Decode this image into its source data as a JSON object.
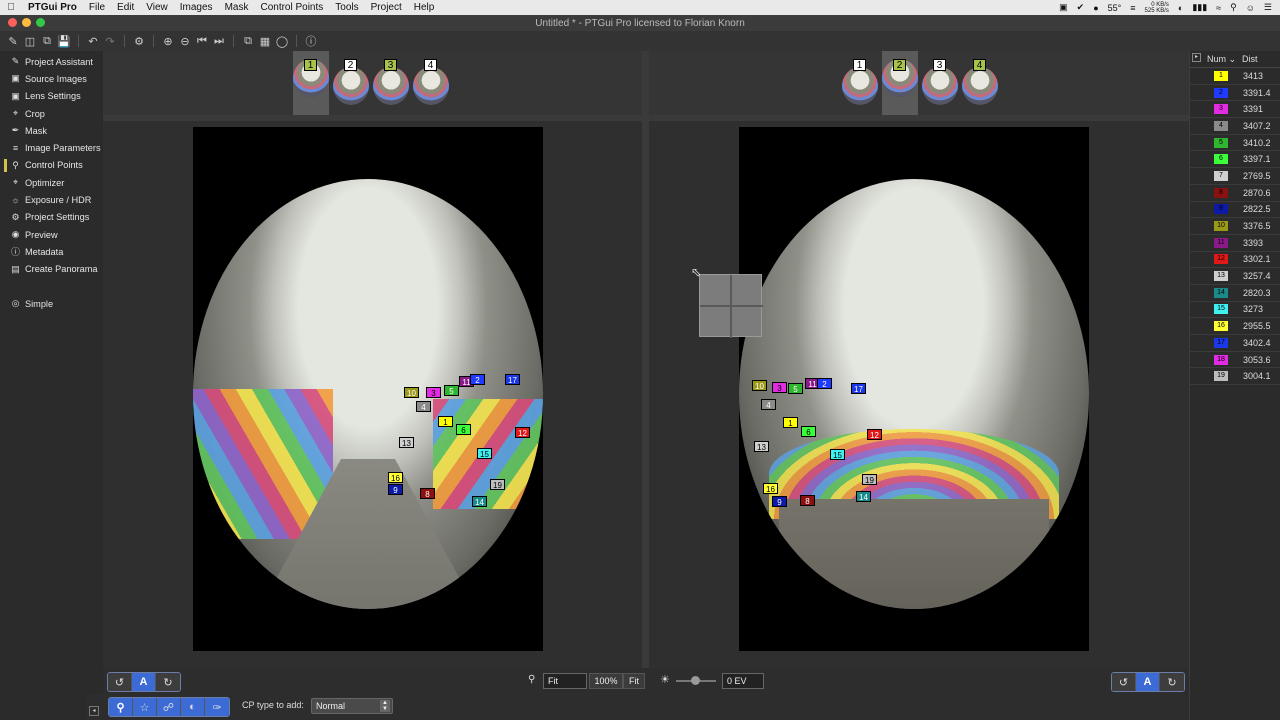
{
  "menubar": {
    "app_name": "PTGui Pro",
    "items": [
      "File",
      "Edit",
      "View",
      "Images",
      "Mask",
      "Control Points",
      "Tools",
      "Project",
      "Help"
    ],
    "temperature": "55°",
    "net_up": "0 KB/s",
    "net_down": "525 KB/s"
  },
  "window": {
    "title": "Untitled * - PTGui Pro licensed to Florian Knorn"
  },
  "sidebar": {
    "items": [
      {
        "label": "Project Assistant",
        "icon": "pencil-icon"
      },
      {
        "label": "Source Images",
        "icon": "images-icon"
      },
      {
        "label": "Lens Settings",
        "icon": "lens-icon"
      },
      {
        "label": "Crop",
        "icon": "crop-icon"
      },
      {
        "label": "Mask",
        "icon": "brush-icon"
      },
      {
        "label": "Image Parameters",
        "icon": "sliders-icon"
      },
      {
        "label": "Control Points",
        "icon": "pin-icon"
      },
      {
        "label": "Optimizer",
        "icon": "optimizer-icon"
      },
      {
        "label": "Exposure / HDR",
        "icon": "sun-icon"
      },
      {
        "label": "Project Settings",
        "icon": "gear-icon"
      },
      {
        "label": "Preview",
        "icon": "eye-icon"
      },
      {
        "label": "Metadata",
        "icon": "info-icon"
      },
      {
        "label": "Create Panorama",
        "icon": "panorama-icon"
      }
    ],
    "active": "Control Points",
    "simple_label": "Simple"
  },
  "left_thumbs": {
    "numbers": [
      "1",
      "2",
      "3",
      "4"
    ],
    "selected": "1",
    "colors": [
      "#a8c34b",
      "#ffffff",
      "#a8c34b",
      "#ffffff"
    ]
  },
  "right_thumbs": {
    "numbers": [
      "1",
      "2",
      "3",
      "4"
    ],
    "selected": "2",
    "colors": [
      "#ffffff",
      "#a8c34b",
      "#ffffff",
      "#a8c34b"
    ]
  },
  "cp_colors": {
    "1": "#ffff00",
    "2": "#1f3bff",
    "3": "#e22be2",
    "4": "#8a8a8a",
    "5": "#2fb52f",
    "6": "#3cff3c",
    "7": "#cfcfcf",
    "8": "#8b1010",
    "9": "#0c1aa6",
    "10": "#9a9a18",
    "11": "#8a1a8a",
    "12": "#e01818",
    "13": "#cfcfcf",
    "14": "#1a8a8a",
    "15": "#3ff0f0",
    "16": "#ffff33",
    "17": "#1a37e8",
    "18": "#e22be2",
    "19": "#bdbdbd"
  },
  "left_cps": [
    "10",
    "3",
    "5",
    "11",
    "2",
    "17",
    "4",
    "1",
    "6",
    "12",
    "13",
    "15",
    "16",
    "9",
    "8",
    "19",
    "14"
  ],
  "right_cps": [
    "10",
    "3",
    "5",
    "11",
    "2",
    "17",
    "4",
    "1",
    "6",
    "12",
    "13",
    "15",
    "19",
    "16",
    "9",
    "8",
    "14"
  ],
  "cp_table": {
    "col_num": "Num",
    "col_dist": "Dist",
    "rows": [
      {
        "num": "1",
        "dist": "3413"
      },
      {
        "num": "2",
        "dist": "3391.4"
      },
      {
        "num": "3",
        "dist": "3391"
      },
      {
        "num": "4",
        "dist": "3407.2"
      },
      {
        "num": "5",
        "dist": "3410.2"
      },
      {
        "num": "6",
        "dist": "3397.1"
      },
      {
        "num": "7",
        "dist": "2769.5"
      },
      {
        "num": "8",
        "dist": "2870.6"
      },
      {
        "num": "9",
        "dist": "2822.5"
      },
      {
        "num": "10",
        "dist": "3376.5"
      },
      {
        "num": "11",
        "dist": "3393"
      },
      {
        "num": "12",
        "dist": "3302.1"
      },
      {
        "num": "13",
        "dist": "3257.4"
      },
      {
        "num": "14",
        "dist": "2820.3"
      },
      {
        "num": "15",
        "dist": "3273"
      },
      {
        "num": "16",
        "dist": "2955.5"
      },
      {
        "num": "17",
        "dist": "3402.4"
      },
      {
        "num": "18",
        "dist": "3053.6"
      },
      {
        "num": "19",
        "dist": "3004.1"
      }
    ]
  },
  "bottom": {
    "zoom_value": "Fit",
    "zoom_100": "100%",
    "zoom_fit": "Fit",
    "exposure_value": "0 EV",
    "cp_type_label": "CP type to add:",
    "cp_type_value": "Normal",
    "auto_label": "A"
  }
}
